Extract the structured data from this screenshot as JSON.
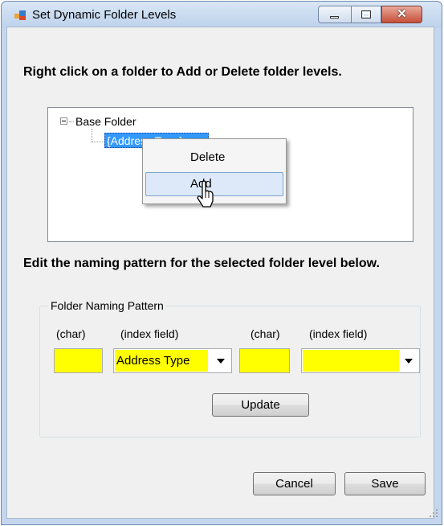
{
  "window": {
    "title": "Set Dynamic Folder Levels",
    "icons": {
      "app": "app-window-icon",
      "minimize": "minimize-icon",
      "maximize": "maximize-icon",
      "close": "close-icon"
    },
    "close_glyph": "✕"
  },
  "instructions": {
    "tree_hint": "Right click on a folder to Add or Delete folder levels.",
    "pattern_hint": "Edit the naming pattern for the selected folder level below."
  },
  "tree": {
    "root": {
      "label": "Base Folder",
      "expanded": true
    },
    "child": {
      "label": "{Address Type}",
      "selected": true
    }
  },
  "context_menu": {
    "items": [
      {
        "label": "Delete"
      },
      {
        "label": "Add",
        "hovered": true
      }
    ]
  },
  "naming_pattern": {
    "group_title": "Folder Naming Pattern",
    "columns": [
      {
        "header": "(char)",
        "value": ""
      },
      {
        "header": "(index field)",
        "value": "Address Type"
      },
      {
        "header": "(char)",
        "value": ""
      },
      {
        "header": "(index field)",
        "value": ""
      }
    ],
    "update_label": "Update"
  },
  "buttons": {
    "cancel": "Cancel",
    "save": "Save"
  },
  "colors": {
    "highlight_field": "#ffff00",
    "selection": "#3399ff",
    "client_bg": "#f0f0f0"
  }
}
